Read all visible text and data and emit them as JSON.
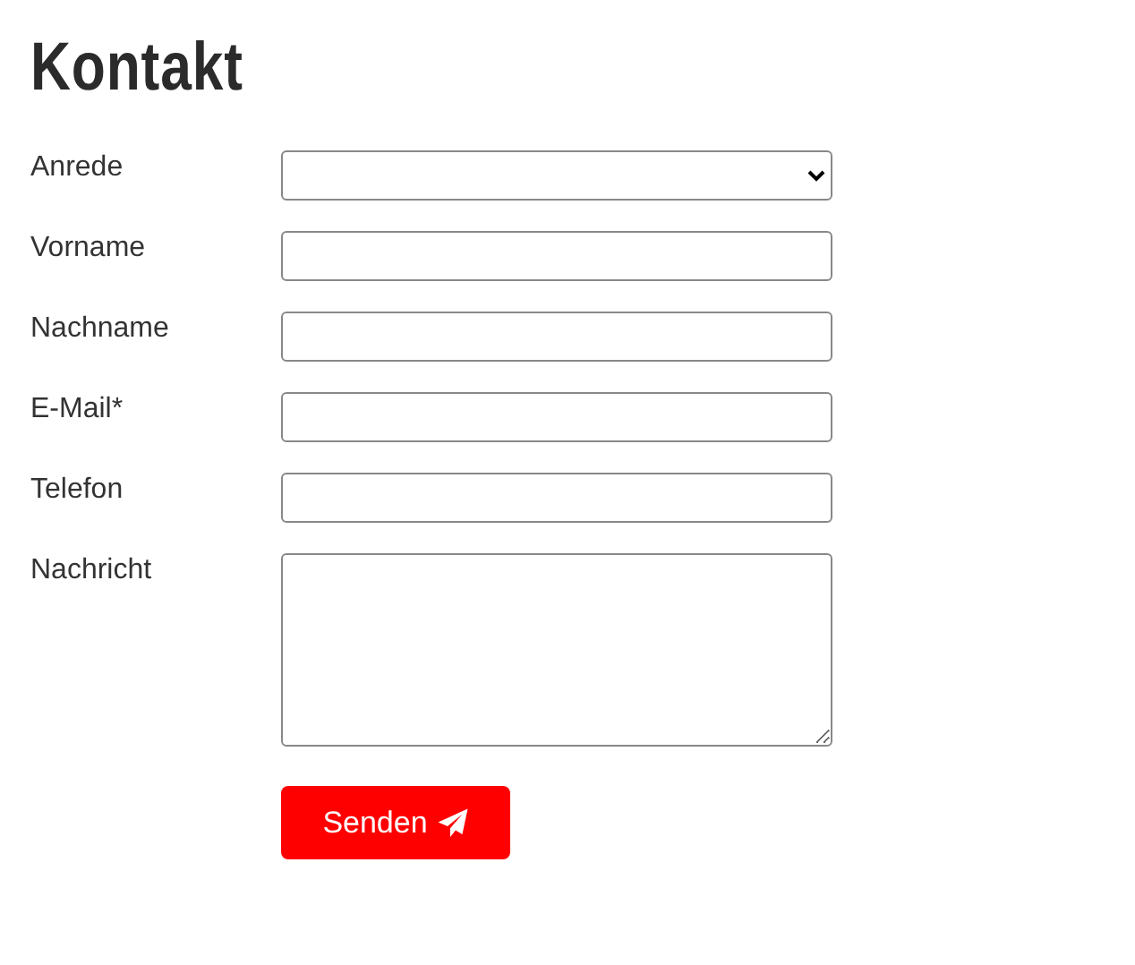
{
  "title": "Kontakt",
  "fields": [
    {
      "label": "Anrede",
      "kind": "select"
    },
    {
      "label": "Vorname",
      "kind": "text"
    },
    {
      "label": "Nachname",
      "kind": "text"
    },
    {
      "label": "E-Mail*",
      "kind": "text"
    },
    {
      "label": "Telefon",
      "kind": "text"
    },
    {
      "label": "Nachricht",
      "kind": "textarea"
    }
  ],
  "submit": {
    "label": "Senden"
  }
}
